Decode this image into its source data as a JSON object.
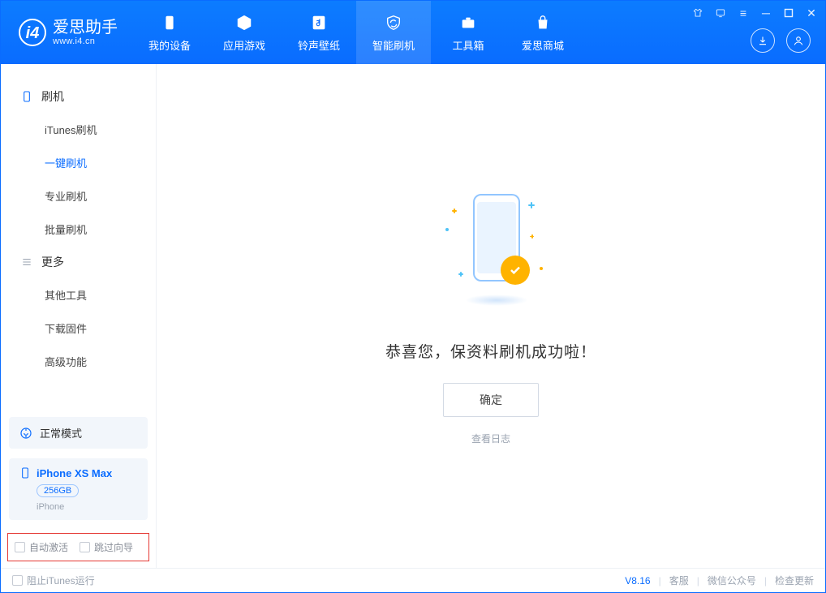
{
  "app": {
    "name_cn": "爱思助手",
    "name_en": "www.i4.cn"
  },
  "nav": {
    "my_device": "我的设备",
    "apps_games": "应用游戏",
    "ringtones": "铃声壁纸",
    "flash": "智能刷机",
    "toolbox": "工具箱",
    "store": "爱思商城"
  },
  "sidebar": {
    "flash_section": "刷机",
    "items": {
      "itunes_flash": "iTunes刷机",
      "one_key_flash": "一键刷机",
      "pro_flash": "专业刷机",
      "batch_flash": "批量刷机"
    },
    "more_section": "更多",
    "more_items": {
      "other_tools": "其他工具",
      "download_firmware": "下载固件",
      "advanced": "高级功能"
    },
    "mode": "正常模式",
    "device": {
      "name": "iPhone XS Max",
      "capacity": "256GB",
      "type": "iPhone"
    },
    "opts": {
      "auto_activate": "自动激活",
      "skip_guide": "跳过向导"
    }
  },
  "main": {
    "success_msg": "恭喜您，保资料刷机成功啦！",
    "ok": "确定",
    "view_log": "查看日志"
  },
  "footer": {
    "block_itunes": "阻止iTunes运行",
    "version": "V8.16",
    "support": "客服",
    "wechat": "微信公众号",
    "check_update": "检查更新"
  }
}
